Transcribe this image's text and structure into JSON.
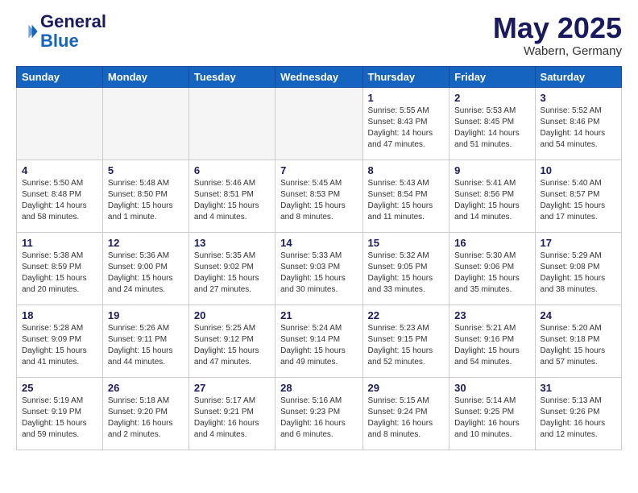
{
  "header": {
    "logo_line1": "General",
    "logo_line2": "Blue",
    "month": "May 2025",
    "location": "Wabern, Germany"
  },
  "weekdays": [
    "Sunday",
    "Monday",
    "Tuesday",
    "Wednesday",
    "Thursday",
    "Friday",
    "Saturday"
  ],
  "weeks": [
    [
      {
        "day": "",
        "info": ""
      },
      {
        "day": "",
        "info": ""
      },
      {
        "day": "",
        "info": ""
      },
      {
        "day": "",
        "info": ""
      },
      {
        "day": "1",
        "info": "Sunrise: 5:55 AM\nSunset: 8:43 PM\nDaylight: 14 hours\nand 47 minutes."
      },
      {
        "day": "2",
        "info": "Sunrise: 5:53 AM\nSunset: 8:45 PM\nDaylight: 14 hours\nand 51 minutes."
      },
      {
        "day": "3",
        "info": "Sunrise: 5:52 AM\nSunset: 8:46 PM\nDaylight: 14 hours\nand 54 minutes."
      }
    ],
    [
      {
        "day": "4",
        "info": "Sunrise: 5:50 AM\nSunset: 8:48 PM\nDaylight: 14 hours\nand 58 minutes."
      },
      {
        "day": "5",
        "info": "Sunrise: 5:48 AM\nSunset: 8:50 PM\nDaylight: 15 hours\nand 1 minute."
      },
      {
        "day": "6",
        "info": "Sunrise: 5:46 AM\nSunset: 8:51 PM\nDaylight: 15 hours\nand 4 minutes."
      },
      {
        "day": "7",
        "info": "Sunrise: 5:45 AM\nSunset: 8:53 PM\nDaylight: 15 hours\nand 8 minutes."
      },
      {
        "day": "8",
        "info": "Sunrise: 5:43 AM\nSunset: 8:54 PM\nDaylight: 15 hours\nand 11 minutes."
      },
      {
        "day": "9",
        "info": "Sunrise: 5:41 AM\nSunset: 8:56 PM\nDaylight: 15 hours\nand 14 minutes."
      },
      {
        "day": "10",
        "info": "Sunrise: 5:40 AM\nSunset: 8:57 PM\nDaylight: 15 hours\nand 17 minutes."
      }
    ],
    [
      {
        "day": "11",
        "info": "Sunrise: 5:38 AM\nSunset: 8:59 PM\nDaylight: 15 hours\nand 20 minutes."
      },
      {
        "day": "12",
        "info": "Sunrise: 5:36 AM\nSunset: 9:00 PM\nDaylight: 15 hours\nand 24 minutes."
      },
      {
        "day": "13",
        "info": "Sunrise: 5:35 AM\nSunset: 9:02 PM\nDaylight: 15 hours\nand 27 minutes."
      },
      {
        "day": "14",
        "info": "Sunrise: 5:33 AM\nSunset: 9:03 PM\nDaylight: 15 hours\nand 30 minutes."
      },
      {
        "day": "15",
        "info": "Sunrise: 5:32 AM\nSunset: 9:05 PM\nDaylight: 15 hours\nand 33 minutes."
      },
      {
        "day": "16",
        "info": "Sunrise: 5:30 AM\nSunset: 9:06 PM\nDaylight: 15 hours\nand 35 minutes."
      },
      {
        "day": "17",
        "info": "Sunrise: 5:29 AM\nSunset: 9:08 PM\nDaylight: 15 hours\nand 38 minutes."
      }
    ],
    [
      {
        "day": "18",
        "info": "Sunrise: 5:28 AM\nSunset: 9:09 PM\nDaylight: 15 hours\nand 41 minutes."
      },
      {
        "day": "19",
        "info": "Sunrise: 5:26 AM\nSunset: 9:11 PM\nDaylight: 15 hours\nand 44 minutes."
      },
      {
        "day": "20",
        "info": "Sunrise: 5:25 AM\nSunset: 9:12 PM\nDaylight: 15 hours\nand 47 minutes."
      },
      {
        "day": "21",
        "info": "Sunrise: 5:24 AM\nSunset: 9:14 PM\nDaylight: 15 hours\nand 49 minutes."
      },
      {
        "day": "22",
        "info": "Sunrise: 5:23 AM\nSunset: 9:15 PM\nDaylight: 15 hours\nand 52 minutes."
      },
      {
        "day": "23",
        "info": "Sunrise: 5:21 AM\nSunset: 9:16 PM\nDaylight: 15 hours\nand 54 minutes."
      },
      {
        "day": "24",
        "info": "Sunrise: 5:20 AM\nSunset: 9:18 PM\nDaylight: 15 hours\nand 57 minutes."
      }
    ],
    [
      {
        "day": "25",
        "info": "Sunrise: 5:19 AM\nSunset: 9:19 PM\nDaylight: 15 hours\nand 59 minutes."
      },
      {
        "day": "26",
        "info": "Sunrise: 5:18 AM\nSunset: 9:20 PM\nDaylight: 16 hours\nand 2 minutes."
      },
      {
        "day": "27",
        "info": "Sunrise: 5:17 AM\nSunset: 9:21 PM\nDaylight: 16 hours\nand 4 minutes."
      },
      {
        "day": "28",
        "info": "Sunrise: 5:16 AM\nSunset: 9:23 PM\nDaylight: 16 hours\nand 6 minutes."
      },
      {
        "day": "29",
        "info": "Sunrise: 5:15 AM\nSunset: 9:24 PM\nDaylight: 16 hours\nand 8 minutes."
      },
      {
        "day": "30",
        "info": "Sunrise: 5:14 AM\nSunset: 9:25 PM\nDaylight: 16 hours\nand 10 minutes."
      },
      {
        "day": "31",
        "info": "Sunrise: 5:13 AM\nSunset: 9:26 PM\nDaylight: 16 hours\nand 12 minutes."
      }
    ]
  ]
}
